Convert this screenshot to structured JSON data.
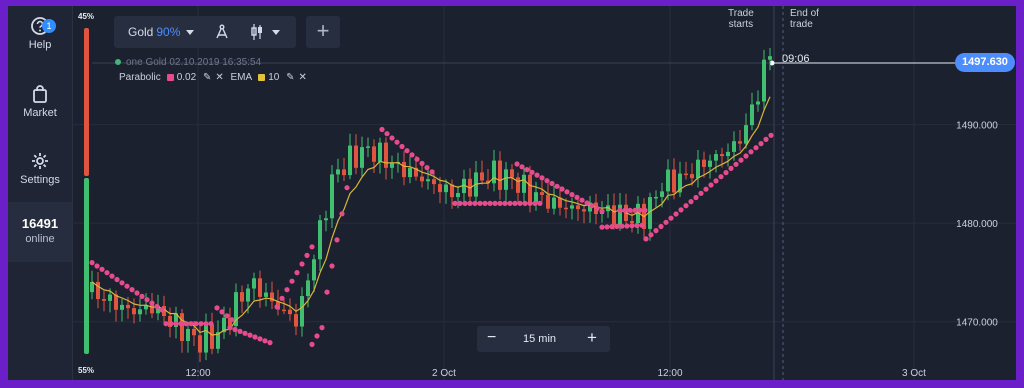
{
  "sidebar": {
    "help": {
      "label": "Help",
      "badge": "1"
    },
    "market": {
      "label": "Market"
    },
    "settings": {
      "label": "Settings"
    },
    "online": {
      "count": "16491",
      "label": "online"
    }
  },
  "toolbar": {
    "asset": "Gold",
    "payout": "90%",
    "add": "+"
  },
  "info": {
    "line1_prefix": "on",
    "line1_rest": "e Gold  02.10.2019 16:35:54",
    "indicators": [
      {
        "name": "Parabolic",
        "color": "#e64b8c",
        "value": "0.02"
      },
      {
        "name": "EMA",
        "color": "#e6c23a",
        "value": "10"
      }
    ]
  },
  "timeframe": {
    "minus": "−",
    "value": "15 min",
    "plus": "+"
  },
  "trade": {
    "starts": [
      "Trade",
      "starts"
    ],
    "end": [
      "End of",
      "trade"
    ],
    "time": "09:06",
    "price": "1497.630"
  },
  "percent": {
    "top": "45%",
    "bottom": "55%"
  },
  "colors": {
    "bull": "#3fbf6f",
    "bear": "#e0553f",
    "sar": "#e64b8c",
    "ema": "#d7b63a",
    "accent": "#4c8dff"
  },
  "chart_data": {
    "type": "candlestick",
    "y_ticks": [
      "1490.000",
      "1480.000",
      "1470.000"
    ],
    "x_ticks": [
      "12:00",
      "2 Oct",
      "12:00",
      "3 Oct"
    ],
    "ylim": [
      1465,
      1500
    ],
    "last_price": 1497.63
  }
}
